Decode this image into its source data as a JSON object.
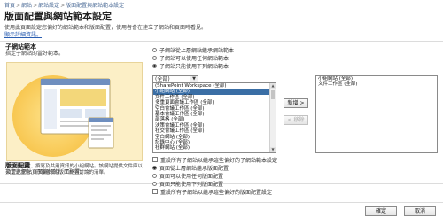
{
  "breadcrumb": [
    "首頁",
    "網站",
    "網站設定",
    "版面配置與網站範本設定"
  ],
  "page_title": "版面配置與網站範本設定",
  "intro": {
    "text": "使用此頁面設定您偏好的網站範本和版面配置，使用者會在建立子網站和頁面時看見。",
    "link": "顯示詳細資訊。"
  },
  "subsite_templates": {
    "title": "子網站範本",
    "description": "指定子網站的當好範本。",
    "options": [
      "子網站從上層網站繼承網站範本",
      "子網站可以使用任何網站範本",
      "子網站只能使用下列網站範本"
    ],
    "selected_option": 2,
    "filter": "(全部)",
    "available_templates": [
      "(SharePoint Workspace (全部)",
      "小組網站 (全部)",
      "文件工作區 (全部)",
      "多重頁面會議工作區 (全部)",
      "空白會議工作區 (全部)",
      "基本會議工作區 (全部)",
      "部落格 (全部)",
      "決策會議工作區 (全部)",
      "社交會議工作區 (全部)",
      "空白網站 (全部)",
      "記錄中心 (全部)",
      "社群網站 (全部)"
    ],
    "selected_available_index": 1,
    "add_button": "新增 >",
    "remove_button": "< 移除",
    "selected_templates": [
      "小組網站 (全部)",
      "文件工作區 (全部)"
    ],
    "reset_checkbox": "重設所有子網站以繼承這些偏好的子網站範本設定",
    "caption": "可快速組織、撰寫及共用資訊的小組網站。該網站提供文件庫以及管理宣告、行事曆項目、工作與討論的清單。"
  },
  "page_layouts": {
    "title": "版面配置",
    "description": "指定此網站頁面偏好的版面配置。",
    "options": [
      "頁面從上層網站繼承版面配置",
      "頁面可以使用任何版面配置",
      "頁面只能使用下列版面配置"
    ],
    "selected_option": 0,
    "reset_checkbox": "重設所有子網站以繼承這些偏好的版面配置設定"
  },
  "footer": {
    "ok_label": "確定",
    "cancel_label": "取消"
  }
}
